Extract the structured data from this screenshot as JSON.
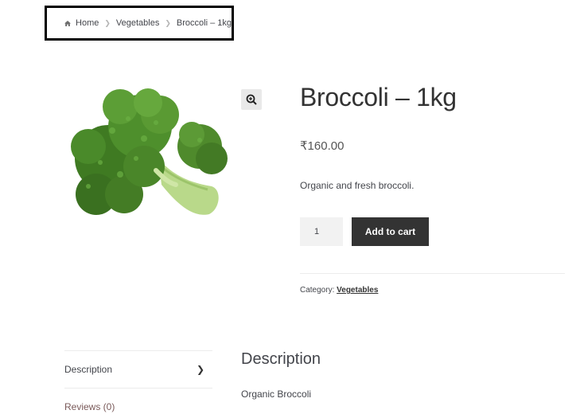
{
  "breadcrumb": {
    "items": [
      "Home",
      "Vegetables",
      "Broccoli – 1kg"
    ],
    "home_icon": "home-icon",
    "separator_icon": "chevron-right-icon"
  },
  "product": {
    "title": "Broccoli – 1kg",
    "price": "₹160.00",
    "short_description": "Organic and fresh broccoli.",
    "image_alt": "broccoli",
    "zoom_icon": "magnifier-zoom-icon",
    "quantity_value": "1",
    "add_to_cart_label": "Add to cart",
    "category_label": "Category:",
    "category_value": "Vegetables"
  },
  "tabs": [
    {
      "label": "Description",
      "active": true
    },
    {
      "label": "Reviews (0)",
      "active": false
    }
  ],
  "panel": {
    "title": "Description",
    "body": "Organic Broccoli"
  },
  "colors": {
    "button_bg": "#333333",
    "qty_bg": "#f2f2f2",
    "broccoli_green": "#4e8f2c"
  }
}
